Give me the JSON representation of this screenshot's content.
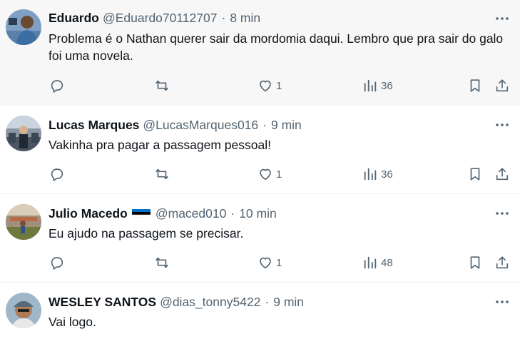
{
  "tweets": [
    {
      "name": "Eduardo",
      "handle": "@Eduardo70112707",
      "dot": "·",
      "time": "8 min",
      "text": "Problema é o Nathan querer sair da mordomia daqui. Lembro que pra sair do galo foi uma novela.",
      "likes": "1",
      "views": "36"
    },
    {
      "name": "Lucas Marques",
      "handle": "@LucasMarques016",
      "dot": "·",
      "time": "9 min",
      "text": "Vakinha pra pagar a passagem pessoal!",
      "likes": "1",
      "views": "36"
    },
    {
      "name": "Julio Macedo",
      "flag": "estonia-flag",
      "handle": "@maced010",
      "dot": "·",
      "time": "10 min",
      "text": "Eu ajudo na passagem se precisar.",
      "likes": "1",
      "views": "48"
    },
    {
      "name": "WESLEY SANTOS",
      "handle": "@dias_tonny5422",
      "dot": "·",
      "time": "9 min",
      "text": "Vai logo."
    }
  ],
  "icons": {
    "more": "more-dots-icon",
    "reply": "reply-bubble-icon",
    "retweet": "retweet-icon",
    "like": "heart-icon",
    "views": "views-bar-chart-icon",
    "bookmark": "bookmark-icon",
    "share": "share-upload-icon"
  },
  "colors": {
    "text_primary": "#0f1419",
    "text_secondary": "#536471",
    "highlight_bg": "#f7f7f7",
    "divider": "#eff3f4"
  }
}
